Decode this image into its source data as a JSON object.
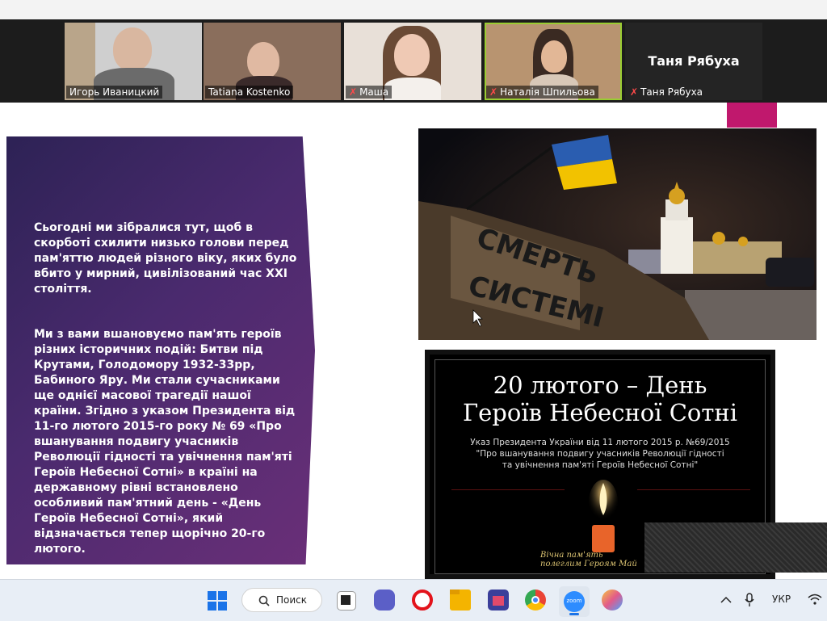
{
  "participants": [
    {
      "name": "Игорь Иваницкий",
      "muted": false
    },
    {
      "name": "Tatiana Kostenko",
      "muted": false
    },
    {
      "name": "Маша",
      "muted": true
    },
    {
      "name": "Наталія Шпильова",
      "muted": true,
      "active": true
    },
    {
      "name": "Таня Рябуха",
      "muted": true,
      "tile_text": "Таня Рябуха"
    }
  ],
  "slide": {
    "para1": "Сьогодні ми зібралися тут, щоб в скорботі схилити низько голови перед пам'яттю людей різного віку, яких було вбито у мирний, цивілізований час XXI століття.",
    "para2": "Ми з вами вшановуємо пам'ять героїв різних історичних подій: Битви під Крутами, Голодомору 1932-33рр, Бабиного Яру. Ми стали сучасниками ще однієї масової трагедії нашої країни. Згідно з указом Президента від 11-го лютого 2015-го року № 69 «Про вшанування подвигу учасників Революції гідності та увічнення пам'яті Героїв Небесної Сотні» в країні на державному рівні встановлено особливий пам'ятний день - «День Героїв Небесної Сотні», який відзначається тепер щорічно 20-го лютого.",
    "photo_text_1": "СМЕРТЬ",
    "photo_text_2": "СИСТЕМІ",
    "poster_title_1": "20 лютого – День",
    "poster_title_2": "Героїв Небесної Сотні",
    "poster_sub_1": "Указ Президента України від 11 лютого 2015 р. №69/2015",
    "poster_sub_2": "\"Про вшанування подвигу учасників Революції гідності",
    "poster_sub_3": "та увічнення пам'яті Героїв Небесної Сотні\"",
    "poster_caption_1": "Вічна пам'ять",
    "poster_caption_2": "полеглим Героям Май"
  },
  "taskbar": {
    "search_label": "Поиск",
    "zoom_label": "zoom",
    "language": "УКР",
    "icons": [
      "windows-start-icon",
      "search-icon",
      "task-view-icon",
      "teams-chat-icon",
      "opera-icon",
      "file-explorer-icon",
      "ms-store-icon",
      "chrome-icon",
      "zoom-icon",
      "paint-icon"
    ]
  },
  "colors": {
    "accent_pink": "#c0186d",
    "active_border": "#9acd32",
    "flag_blue": "#2a5db0",
    "flag_yellow": "#f2c200"
  }
}
